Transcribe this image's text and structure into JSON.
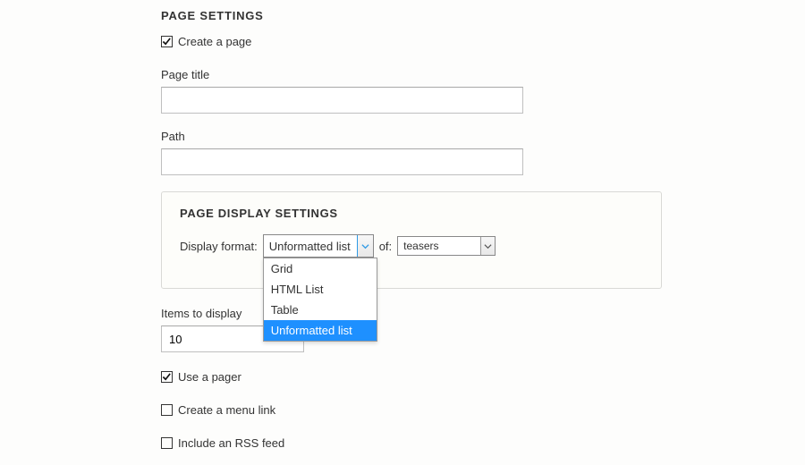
{
  "page_settings": {
    "heading": "PAGE SETTINGS",
    "create_page_label": "Create a page",
    "create_page_checked": true,
    "page_title_label": "Page title",
    "page_title_value": "",
    "path_label": "Path",
    "path_value": ""
  },
  "display_settings": {
    "heading": "PAGE DISPLAY SETTINGS",
    "display_format_label": "Display format:",
    "of_label": "of:",
    "format_select": {
      "value": "Unformatted list",
      "options": [
        "Grid",
        "HTML List",
        "Table",
        "Unformatted list"
      ],
      "highlighted": "Unformatted list"
    },
    "row_style_select": {
      "value": "teasers"
    }
  },
  "misc": {
    "items_to_display_label": "Items to display",
    "items_to_display_value": "10",
    "use_pager_label": "Use a pager",
    "use_pager_checked": true,
    "menu_link_label": "Create a menu link",
    "menu_link_checked": false,
    "rss_label": "Include an RSS feed",
    "rss_checked": false
  }
}
